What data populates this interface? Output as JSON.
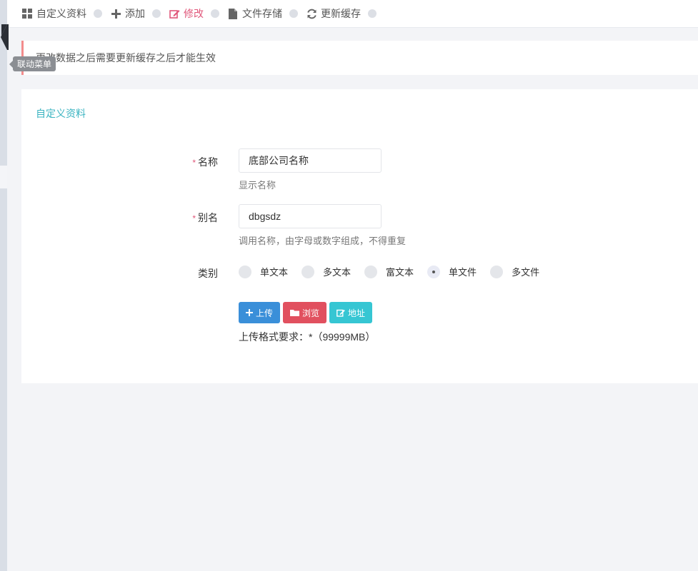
{
  "toolbar": {
    "items": [
      {
        "label": "自定义资料",
        "icon": "grid-icon",
        "active": false
      },
      {
        "label": "添加",
        "icon": "plus-icon",
        "active": false
      },
      {
        "label": "修改",
        "icon": "edit-icon",
        "active": true
      },
      {
        "label": "文件存储",
        "icon": "file-icon",
        "active": false
      },
      {
        "label": "更新缓存",
        "icon": "refresh-icon",
        "active": false
      }
    ]
  },
  "tooltip": "联动菜单",
  "notice": "更改数据之后需要更新缓存之后才能生效",
  "panel": {
    "title": "自定义资料",
    "fields": {
      "name": {
        "label": "名称",
        "value": "底部公司名称",
        "help": "显示名称"
      },
      "alias": {
        "label": "别名",
        "value": "dbgsdz",
        "help": "调用名称，由字母或数字组成，不得重复"
      },
      "type": {
        "label": "类别",
        "options": [
          "单文本",
          "多文本",
          "富文本",
          "单文件",
          "多文件"
        ],
        "selected": "单文件"
      }
    },
    "buttons": {
      "upload": "上传",
      "browse": "浏览",
      "url": "地址"
    },
    "upload_requirement": "上传格式要求：*（99999MB）"
  },
  "colors": {
    "accent": "#e0577a",
    "title": "#3bb4c1",
    "blue": "#3a8fd9",
    "red": "#e1505f",
    "teal": "#36c6d3"
  }
}
